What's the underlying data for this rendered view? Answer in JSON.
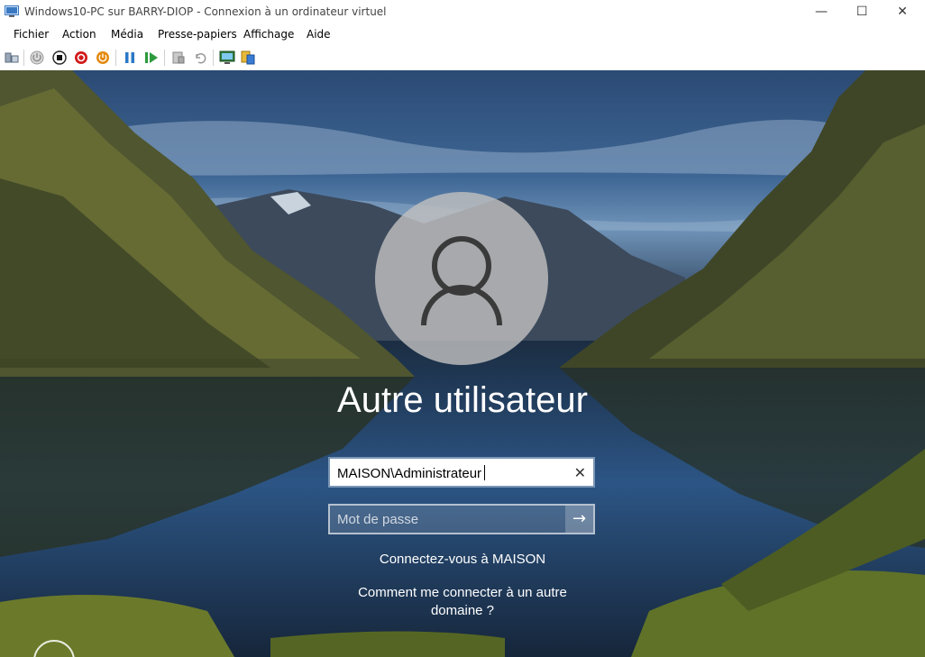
{
  "window": {
    "title": "Windows10-PC sur BARRY-DIOP - Connexion à un ordinateur virtuel",
    "minimize_glyph": "—",
    "maximize_glyph": "☐",
    "close_glyph": "✕"
  },
  "menubar": {
    "items": [
      "Fichier",
      "Action",
      "Média",
      "Presse-papiers",
      "Affichage",
      "Aide"
    ]
  },
  "toolbar": {
    "icons": [
      "ctrl-alt-del-icon",
      "start-icon",
      "turn-off-icon",
      "shutdown-icon",
      "power-icon",
      "pause-icon",
      "resume-icon",
      "checkpoint-icon",
      "revert-icon",
      "enhanced-session-icon",
      "share-icon"
    ]
  },
  "login": {
    "username": "Autre utilisateur",
    "user_field_value": "MAISON\\Administrateur",
    "clear_glyph": "✕",
    "password_placeholder": "Mot de passe",
    "submit_glyph": "→",
    "sign_in_to": "Connectez-vous à MAISON",
    "other_domain": "Comment me connecter à un autre domaine ?"
  },
  "colors": {
    "accent_field_border": "#7a95b6",
    "text_on_bg": "#ffffff"
  }
}
